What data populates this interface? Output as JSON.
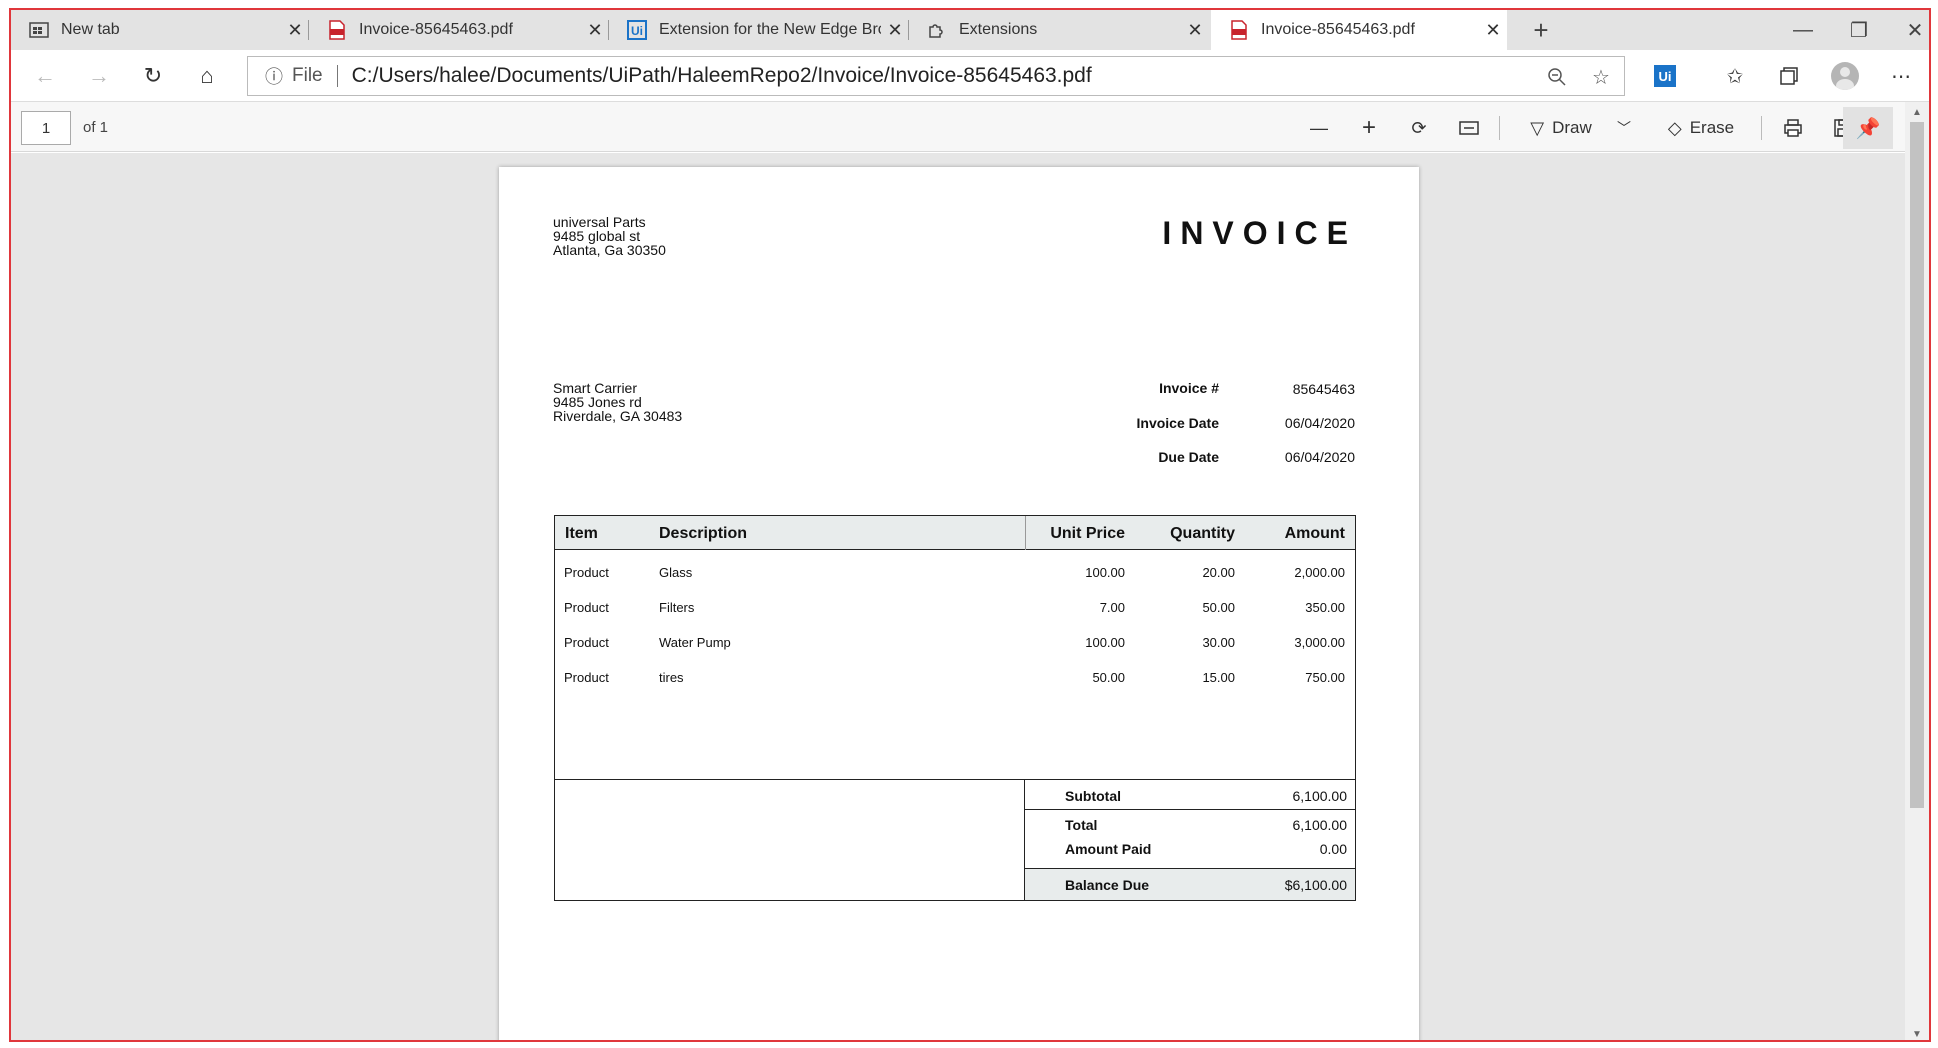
{
  "tabs": [
    {
      "label": "New tab",
      "icon": "newtab-icon"
    },
    {
      "label": "Invoice-85645463.pdf",
      "icon": "pdf-icon"
    },
    {
      "label": "Extension for the New Edge Brov",
      "icon": "uipath-icon"
    },
    {
      "label": "Extensions",
      "icon": "puzzle-icon"
    },
    {
      "label": "Invoice-85645463.pdf",
      "icon": "pdf-icon",
      "active": true
    }
  ],
  "address": {
    "scheme": "File",
    "url": "C:/Users/halee/Documents/UiPath/HaleemRepo2/Invoice/Invoice-85645463.pdf"
  },
  "extension_badge": "Ui",
  "pdf_toolbar": {
    "page": "1",
    "of": "of 1",
    "draw": "Draw",
    "erase": "Erase"
  },
  "invoice": {
    "title": "INVOICE",
    "from": [
      "universal Parts",
      "9485 global st",
      "Atlanta, Ga 30350"
    ],
    "to": [
      "Smart Carrier",
      "9485 Jones rd",
      "Riverdale, GA 30483"
    ],
    "meta": [
      {
        "label": "Invoice #",
        "value": "85645463"
      },
      {
        "label": "Invoice Date",
        "value": "06/04/2020"
      },
      {
        "label": "Due Date",
        "value": "06/04/2020"
      }
    ],
    "columns": [
      "Item",
      "Description",
      "Unit Price",
      "Quantity",
      "Amount"
    ],
    "rows": [
      {
        "item": "Product",
        "description": "Glass",
        "unit_price": "100.00",
        "quantity": "20.00",
        "amount": "2,000.00"
      },
      {
        "item": "Product",
        "description": "Filters",
        "unit_price": "7.00",
        "quantity": "50.00",
        "amount": "350.00"
      },
      {
        "item": "Product",
        "description": "Water Pump",
        "unit_price": "100.00",
        "quantity": "30.00",
        "amount": "3,000.00"
      },
      {
        "item": "Product",
        "description": "tires",
        "unit_price": "50.00",
        "quantity": "15.00",
        "amount": "750.00"
      }
    ],
    "subtotal_label": "Subtotal",
    "subtotal": "6,100.00",
    "total_label": "Total",
    "total": "6,100.00",
    "paid_label": "Amount Paid",
    "paid": "0.00",
    "balance_label": "Balance Due",
    "balance": "$6,100.00"
  },
  "colors": {
    "window_border": "#e0363b",
    "table_header": "#e8ecec",
    "ui_badge": "#1a73c8"
  }
}
